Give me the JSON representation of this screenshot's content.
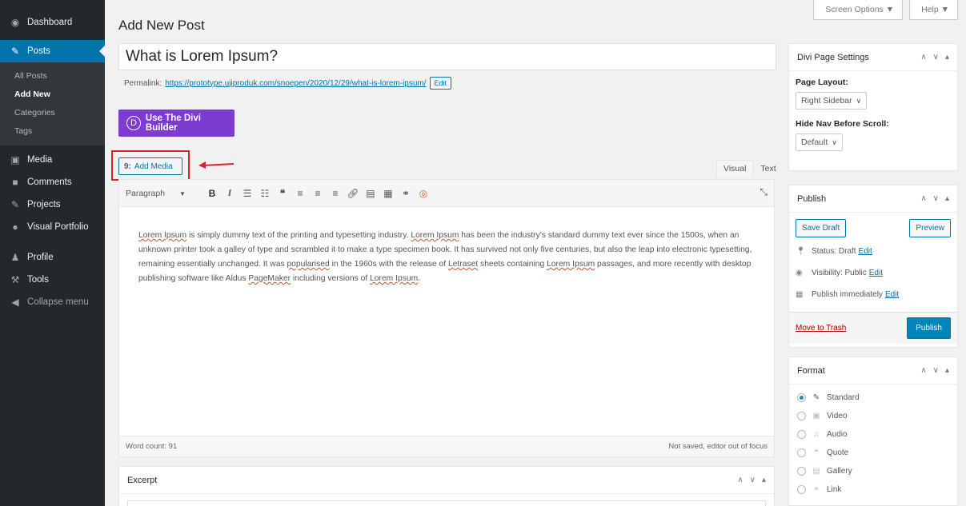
{
  "sidebar": {
    "dashboard": "Dashboard",
    "posts": "Posts",
    "submenu": [
      "All Posts",
      "Add New",
      "Categories",
      "Tags"
    ],
    "media": "Media",
    "comments": "Comments",
    "projects": "Projects",
    "visual_portfolio": "Visual Portfolio",
    "profile": "Profile",
    "tools": "Tools",
    "collapse": "Collapse menu"
  },
  "header": {
    "title": "Add New Post",
    "screen_options": "Screen Options ▼",
    "help": "Help ▼"
  },
  "post": {
    "title": "What is Lorem Ipsum?",
    "permalink_label": "Permalink:",
    "permalink_url": "https://prototype.ujiproduk.com/snoepen/2020/12/29/what-is-lorem-ipsum/",
    "edit_label": "Edit"
  },
  "divi": {
    "letter": "D",
    "label": "Use The Divi Builder"
  },
  "media": {
    "add_media": "Add Media"
  },
  "editor": {
    "tab_visual": "Visual",
    "tab_text": "Text",
    "format_select": "Paragraph",
    "word_count": "Word count: 91",
    "status": "Not saved, editor out of focus",
    "content_parts": [
      "Lorem Ipsum",
      " is simply dummy text of the printing and typesetting industry. ",
      "Lorem Ipsum",
      " has been the industry's standard dummy text ever since the 1500s, when an unknown printer took a galley of type and scrambled it to make a type specimen book. It has survived not only five centuries, but also the leap into electronic typesetting, remaining essentially unchanged. It was ",
      "popularised",
      " in the 1960s with the release of ",
      "Letraset",
      " sheets containing ",
      "Lorem Ipsum",
      " passages, and more recently with desktop publishing software like Aldus ",
      "PageMaker",
      " including versions of ",
      "Lorem Ipsum",
      "."
    ]
  },
  "excerpt": {
    "title": "Excerpt"
  },
  "divi_settings": {
    "title": "Divi Page Settings",
    "page_layout_label": "Page Layout:",
    "page_layout_value": "Right Sidebar",
    "hide_nav_label": "Hide Nav Before Scroll:",
    "hide_nav_value": "Default"
  },
  "publish": {
    "title": "Publish",
    "save_draft": "Save Draft",
    "preview": "Preview",
    "status_text": "Status: Draft",
    "visibility_text": "Visibility: Public",
    "schedule_text": "Publish immediately",
    "edit": "Edit",
    "move_to_trash": "Move to Trash",
    "publish_btn": "Publish"
  },
  "format": {
    "title": "Format",
    "options": [
      "Standard",
      "Video",
      "Audio",
      "Quote",
      "Gallery",
      "Link"
    ],
    "selected": "Standard"
  },
  "colors": {
    "accent": "#0073aa",
    "divi": "#7e3bd0",
    "sidebar": "#23282d",
    "highlight": "#d9232d"
  }
}
